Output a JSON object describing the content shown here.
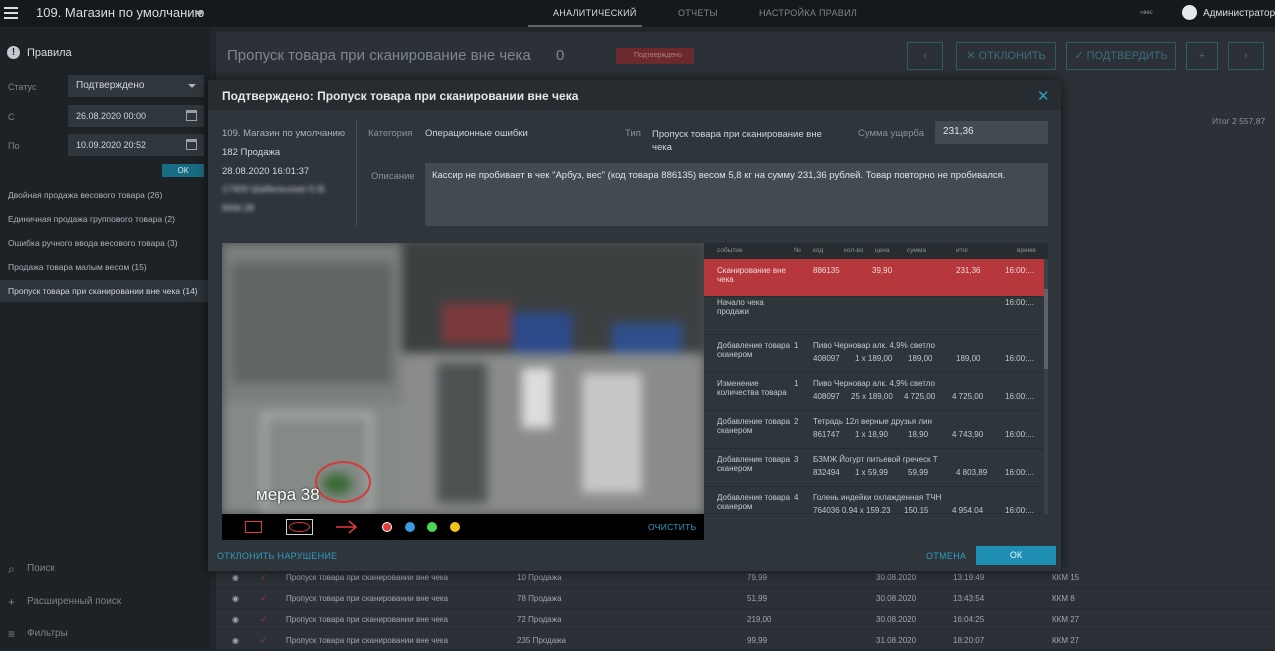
{
  "topbar": {
    "store": "109. Магазин по умолчанию",
    "nav": [
      "АНАЛИТИЧЕСКИЙ",
      "ОТЧЕТЫ",
      "НАСТРОЙКА ПРАВИЛ"
    ],
    "lang": "«вес",
    "user": "Администратор"
  },
  "sidebar": {
    "title": "Правила",
    "status_label": "Статус",
    "status_value": "Подтверждено",
    "from_label": "С",
    "from_value": "26.08.2020 00:00",
    "to_label": "По",
    "to_value": "10.09.2020 20:52",
    "ok": "ОК",
    "rules": [
      "Двойная продажа весового товара (26)",
      "Единичная продажа группового товара (2)",
      "Ошибка ручного ввода весового товара (3)",
      "Продажа товара малым весом (15)",
      "Пропуск товара при сканировании вне чека (14)"
    ],
    "search": "Поиск",
    "advanced_search": "Расширенный поиск",
    "filters": "Фильтры"
  },
  "main": {
    "title": "Пропуск товара при сканирование вне чека",
    "count": "0",
    "badge": "Подтверждено",
    "reject_btn": "ОТКЛОНИТЬ",
    "confirm_btn": "ПОДТВЕРДИТЬ",
    "itog": "Итог 2 557,87",
    "rows": [
      {
        "name": "Пропуск товара при сканировании вне чека",
        "sale": "10 Продажа",
        "sum": "79,99",
        "date": "30.08.2020",
        "time": "13:19:49",
        "kkm": "ККМ 15"
      },
      {
        "name": "Пропуск товара при сканировании вне чека",
        "sale": "78 Продажа",
        "sum": "51,99",
        "date": "30.08.2020",
        "time": "13:43:54",
        "kkm": "ККМ 8"
      },
      {
        "name": "Пропуск товара при сканировании вне чека",
        "sale": "72 Продажа",
        "sum": "219,00",
        "date": "30.08.2020",
        "time": "16:04:25",
        "kkm": "ККМ 27"
      },
      {
        "name": "Пропуск товара при сканировании вне чека",
        "sale": "235 Продажа",
        "sum": "99,99",
        "date": "31.08.2020",
        "time": "18:20:07",
        "kkm": "ККМ 27"
      }
    ]
  },
  "modal": {
    "title": "Подтверждено: Пропуск товара при сканировании вне чека",
    "store": "109. Магазин по умолчанию",
    "sale": "182 Продажа",
    "datetime": "28.08.2020 16:01:37",
    "cashier_blur": "17400 Шабельская О.В.",
    "kkm_blur": "ККМ 28",
    "category_label": "Категория",
    "category_value": "Операционные ошибки",
    "type_label": "Тип",
    "type_value": "Пропуск товара при сканирование вне чека",
    "damage_label": "Сумма ущерба",
    "damage_value": "231,36",
    "desc_label": "Описание",
    "desc_value": "Кассир не пробивает в чек \"Арбуз, вес\" (код товара 886135) весом 5,8 кг на сумму 231,36 рублей. Товар повторно не пробивался.",
    "camera_label": "мера 38",
    "clear": "ОЧИСТИТЬ",
    "reject": "ОТКЛОНИТЬ НАРУШЕНИЕ",
    "cancel": "ОТМЕНА",
    "ok": "ОК",
    "draw_colors": [
      "#e43b3b",
      "#3a9be0",
      "#4fd65a",
      "#f2c21b"
    ],
    "events_header": {
      "event": "событие",
      "num": "№",
      "code": "код",
      "qty": "кол-во",
      "price": "цена",
      "sum": "сумма",
      "total": "итог",
      "time": "время"
    },
    "events": [
      {
        "event": "Сканирование вне чека",
        "num": "",
        "name": "",
        "code": "886135",
        "qty": "",
        "price": "39,90",
        "sum": "",
        "total": "231,36",
        "time": "16:00:..."
      },
      {
        "event": "Начало чека продажи",
        "num": "",
        "name": "",
        "code": "",
        "qty": "",
        "price": "",
        "sum": "",
        "total": "",
        "time": "16:00:..."
      },
      {
        "event": "Добавление товара сканером",
        "num": "1",
        "name": "Пиво Черновар алк. 4,9% светло",
        "code": "408097",
        "qty": "1 x 189,00",
        "price": "",
        "sum": "189,00",
        "total": "189,00",
        "time": "16:00:..."
      },
      {
        "event": "Изменение количества товара",
        "num": "1",
        "name": "Пиво Черновар алк. 4,9% светло",
        "code": "408097",
        "qty": "25 x 189,00",
        "price": "",
        "sum": "4 725,00",
        "total": "4 725,00",
        "time": "16:00:..."
      },
      {
        "event": "Добавление товара сканером",
        "num": "2",
        "name": "Тетрадь 12л верные друзья лин",
        "code": "861747",
        "qty": "1 x 18,90",
        "price": "",
        "sum": "18,90",
        "total": "4 743,90",
        "time": "16:00:..."
      },
      {
        "event": "Добавление товара сканером",
        "num": "3",
        "name": "БЗМЖ Йогурт питьевой греческ Т",
        "code": "832494",
        "qty": "1 x 59,99",
        "price": "",
        "sum": "59,99",
        "total": "4 803,89",
        "time": "16:00:..."
      },
      {
        "event": "Добавление товара сканером",
        "num": "4",
        "name": "Голень индейки охлажденная ТЧН",
        "code": "764036",
        "qty": "0,94 x 159,23",
        "price": "",
        "sum": "150,15",
        "total": "4 954,04",
        "time": "16:00:..."
      }
    ]
  }
}
